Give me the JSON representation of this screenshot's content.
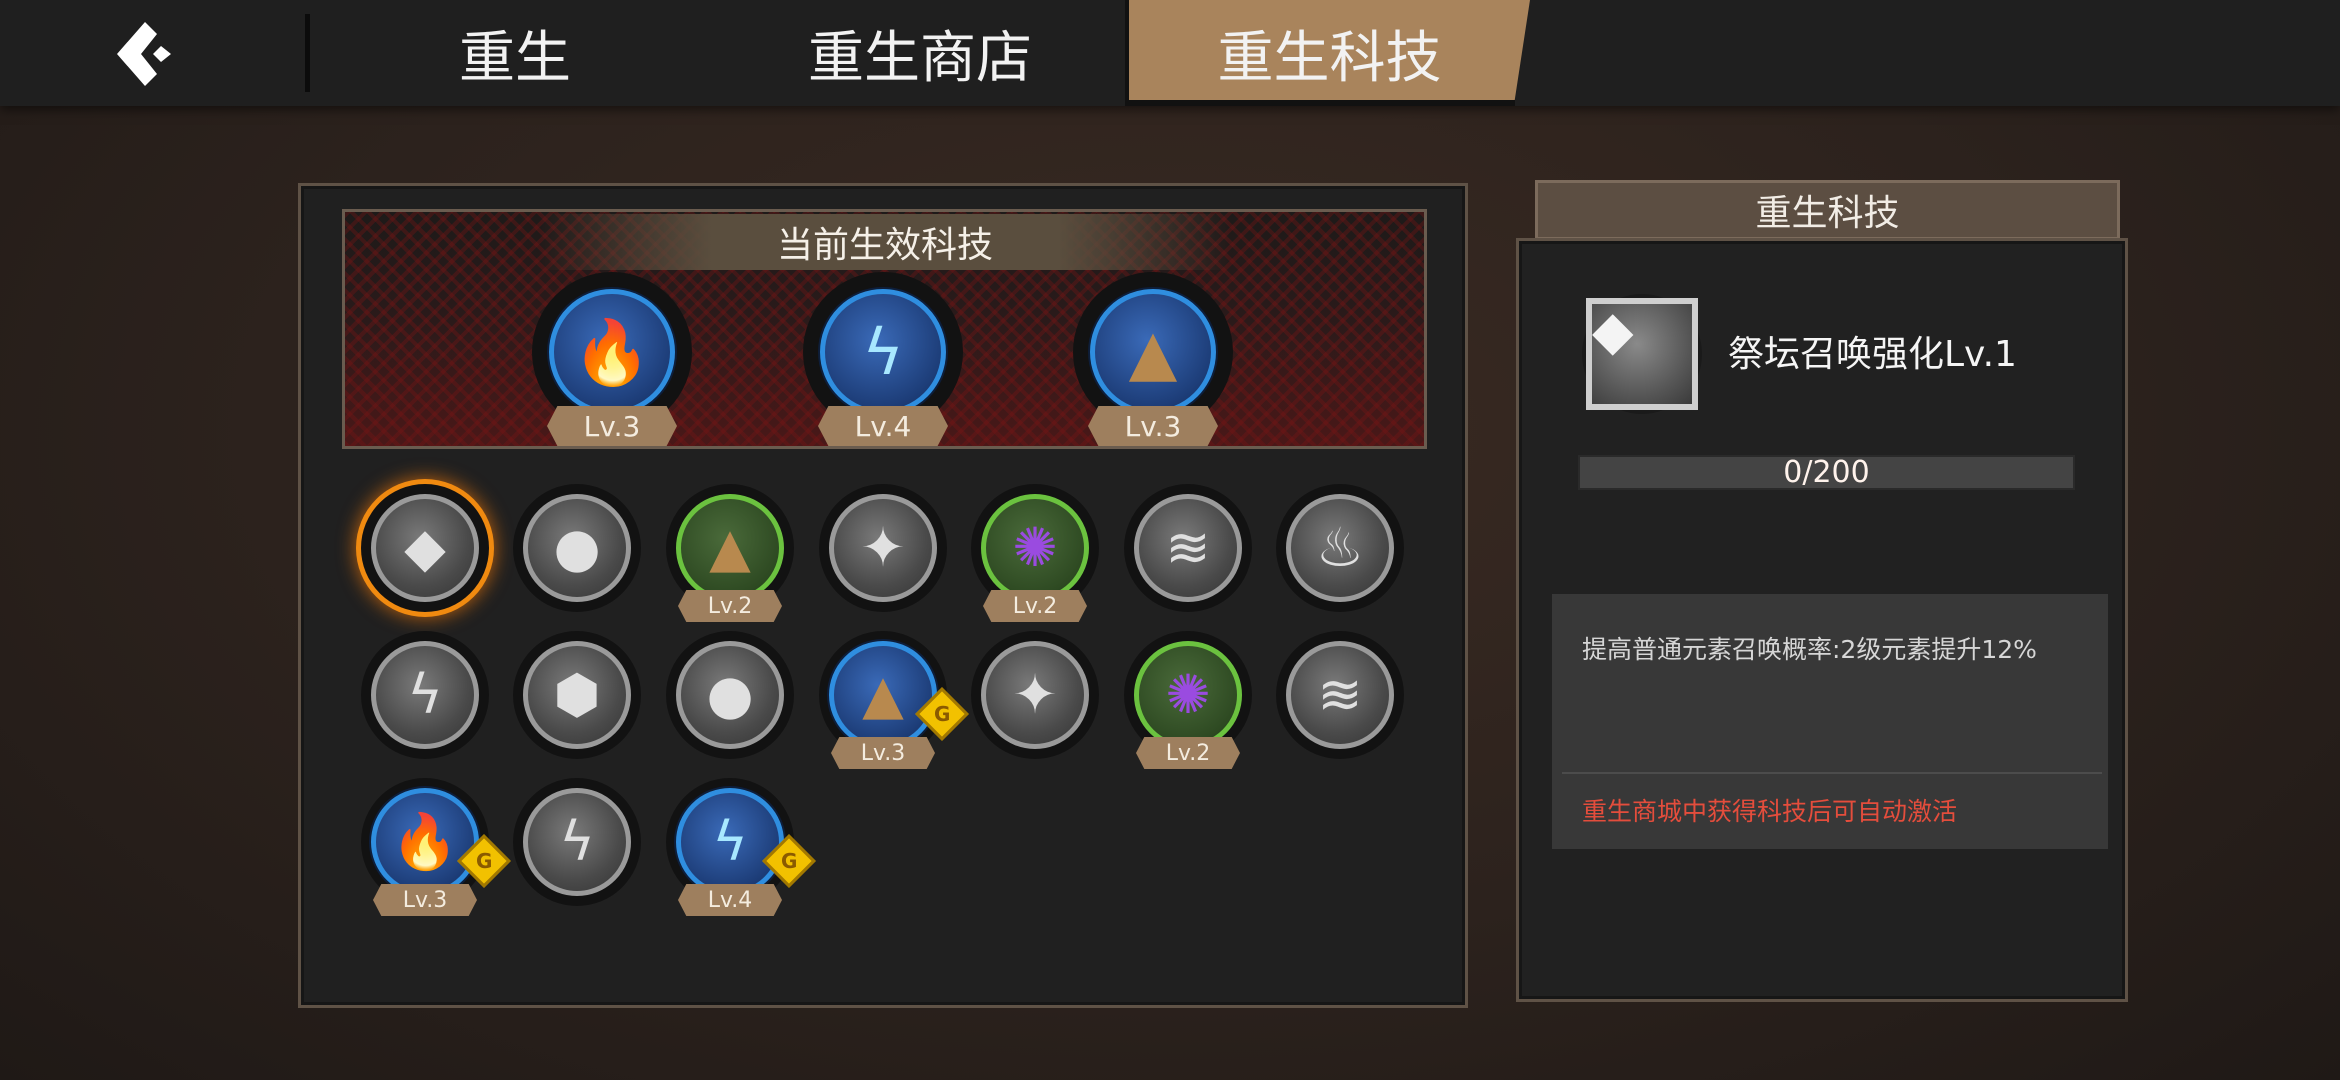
{
  "header": {
    "tabs": [
      {
        "label": "重生"
      },
      {
        "label": "重生商店"
      },
      {
        "label": "重生科技"
      }
    ],
    "active_tab": "重生科技"
  },
  "active_tech": {
    "title": "当前生效科技",
    "items": [
      {
        "icon": "fire-icon",
        "level": "Lv.3"
      },
      {
        "icon": "lightning-dragon-icon",
        "level": "Lv.4"
      },
      {
        "icon": "earth-icon",
        "level": "Lv.3"
      }
    ]
  },
  "tech_grid": [
    {
      "icon": "crystal-icon",
      "style": "gray",
      "level": "",
      "selected": true,
      "badge": false
    },
    {
      "icon": "water-drop-icon",
      "style": "gray",
      "level": "",
      "selected": false,
      "badge": false
    },
    {
      "icon": "earth-icon",
      "style": "green",
      "level": "Lv.2",
      "selected": false,
      "badge": false
    },
    {
      "icon": "stone-icon",
      "style": "gray",
      "level": "",
      "selected": false,
      "badge": false
    },
    {
      "icon": "dark-vortex-icon",
      "style": "green",
      "level": "Lv.2",
      "selected": false,
      "badge": false
    },
    {
      "icon": "wind-icon",
      "style": "gray",
      "level": "",
      "selected": false,
      "badge": false
    },
    {
      "icon": "dark-fire-icon",
      "style": "gray",
      "level": "",
      "selected": false,
      "badge": false
    },
    {
      "icon": "lightning-icon",
      "style": "gray",
      "level": "",
      "selected": false,
      "badge": false
    },
    {
      "icon": "shadow-icon",
      "style": "gray",
      "level": "",
      "selected": false,
      "badge": false
    },
    {
      "icon": "water-drop-icon",
      "style": "gray",
      "level": "",
      "selected": false,
      "badge": false
    },
    {
      "icon": "earth-icon",
      "style": "blue",
      "level": "Lv.3",
      "selected": false,
      "badge": true
    },
    {
      "icon": "stone-icon",
      "style": "gray",
      "level": "",
      "selected": false,
      "badge": false
    },
    {
      "icon": "dark-vortex-icon",
      "style": "green",
      "level": "Lv.2",
      "selected": false,
      "badge": false
    },
    {
      "icon": "wind-icon",
      "style": "gray",
      "level": "",
      "selected": false,
      "badge": false
    },
    {
      "icon": "fire-icon",
      "style": "blue",
      "level": "Lv.3",
      "selected": false,
      "badge": true
    },
    {
      "icon": "lightning-icon",
      "style": "gray",
      "level": "",
      "selected": false,
      "badge": false
    },
    {
      "icon": "lightning-dragon-icon",
      "style": "blue",
      "level": "Lv.4",
      "selected": false,
      "badge": true
    }
  ],
  "badge_letter": "G",
  "detail": {
    "header": "重生科技",
    "icon": "crystal-icon",
    "name": "祭坛召唤强化Lv.1",
    "progress_text": "0/200",
    "progress_fraction": 0,
    "description": "提高普通元素召唤概率:2级元素提升12%",
    "hint": "重生商城中获得科技后可自动激活"
  },
  "colors": {
    "accent_tab": "#a9845c",
    "progress": "#ff6b45",
    "hint": "#e44d3c",
    "selected_glow": "#f08a10",
    "badge": "#f2c100"
  }
}
